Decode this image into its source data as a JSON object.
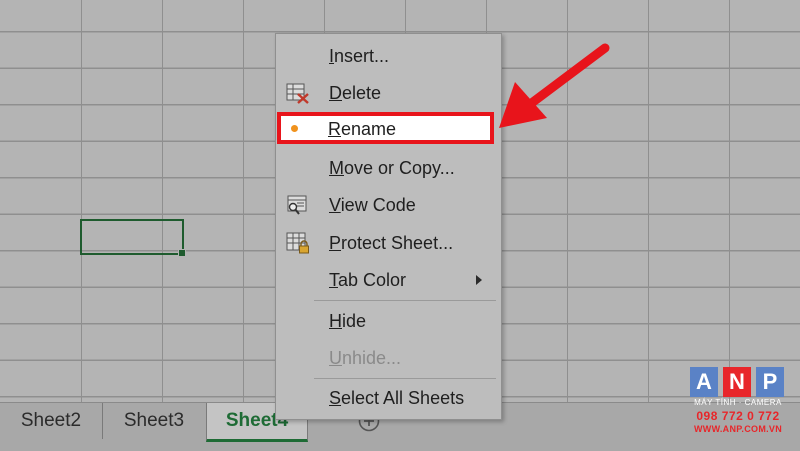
{
  "context_menu": {
    "items": [
      {
        "pre": "",
        "ul": "I",
        "post": "nsert...",
        "icon": "",
        "disabled": false
      },
      {
        "pre": "",
        "ul": "D",
        "post": "elete",
        "icon": "delete-sheet-icon",
        "disabled": false
      },
      {
        "pre": "",
        "ul": "R",
        "post": "ename",
        "icon": "",
        "disabled": false
      },
      {
        "pre": "",
        "ul": "M",
        "post": "ove or Copy...",
        "icon": "",
        "disabled": false
      },
      {
        "pre": "",
        "ul": "V",
        "post": "iew Code",
        "icon": "view-code-icon",
        "disabled": false
      },
      {
        "pre": "",
        "ul": "P",
        "post": "rotect Sheet...",
        "icon": "protect-sheet-icon",
        "disabled": false
      },
      {
        "pre": "",
        "ul": "T",
        "post": "ab Color",
        "icon": "",
        "disabled": false
      },
      {
        "pre": "",
        "ul": "H",
        "post": "ide",
        "icon": "",
        "disabled": false
      },
      {
        "pre": "",
        "ul": "U",
        "post": "nhide...",
        "icon": "",
        "disabled": true
      },
      {
        "pre": "",
        "ul": "S",
        "post": "elect All Sheets",
        "icon": "",
        "disabled": false
      }
    ],
    "highlighted_item": "Rename"
  },
  "sheet_tabs": {
    "tabs": [
      "Sheet2",
      "Sheet3",
      "Sheet4"
    ],
    "active": "Sheet4"
  },
  "logo": {
    "letters": [
      "A",
      "N",
      "P"
    ],
    "tagline": "MÁY TÍNH · CAMERA",
    "phone": "098 772 0 772",
    "url": "WWW.ANP.COM.VN"
  },
  "colors": {
    "highlight_border": "#e8141b",
    "arrow": "#e8141b",
    "active_tab_text": "#1e6b35",
    "logo_blue": "#5a82c6",
    "logo_red": "#e8262a"
  }
}
